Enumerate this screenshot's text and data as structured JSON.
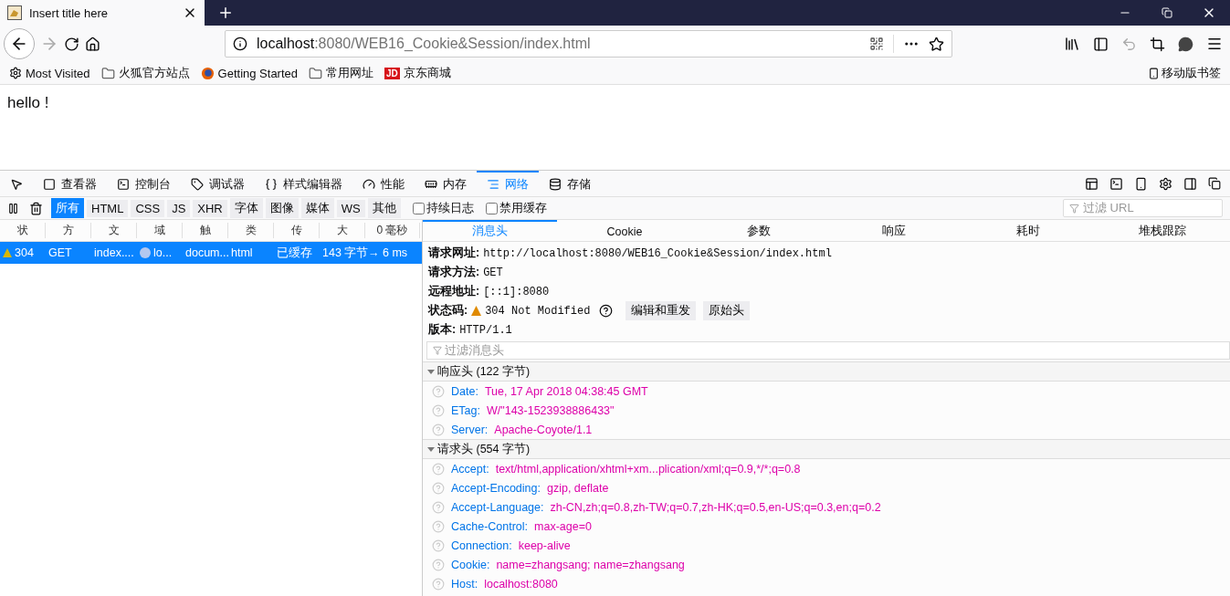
{
  "browser": {
    "tab": {
      "title": "Insert title here"
    },
    "url": {
      "host": "localhost",
      "rest": ":8080/WEB16_Cookie&Session/index.html"
    },
    "bookmarks": [
      {
        "kind": "gear",
        "label": "Most Visited"
      },
      {
        "kind": "folder",
        "label": "火狐官方站点"
      },
      {
        "kind": "firefox",
        "label": "Getting Started"
      },
      {
        "kind": "folder",
        "label": "常用网址"
      },
      {
        "kind": "jd",
        "logo": "JD",
        "label": "京东商城"
      }
    ],
    "mobile_bookmarks": "移动版书签",
    "page_text": "hello !"
  },
  "devtools": {
    "tools": [
      {
        "kind": "viewer",
        "label": "查看器",
        "selected": false
      },
      {
        "kind": "console",
        "label": "控制台",
        "selected": false
      },
      {
        "kind": "debugger",
        "label": "调试器",
        "selected": false
      },
      {
        "kind": "style",
        "label": "样式编辑器",
        "selected": false
      },
      {
        "kind": "perf",
        "label": "性能",
        "selected": false
      },
      {
        "kind": "memory",
        "label": "内存",
        "selected": false
      },
      {
        "kind": "network",
        "label": "网络",
        "selected": true
      },
      {
        "kind": "storage",
        "label": "存储",
        "selected": false
      }
    ],
    "filters": [
      {
        "label": "所有",
        "selected": true
      },
      {
        "label": "HTML",
        "selected": false
      },
      {
        "label": "CSS",
        "selected": false
      },
      {
        "label": "JS",
        "selected": false
      },
      {
        "label": "XHR",
        "selected": false
      },
      {
        "label": "字体",
        "selected": false
      },
      {
        "label": "图像",
        "selected": false
      },
      {
        "label": "媒体",
        "selected": false
      },
      {
        "label": "WS",
        "selected": false
      },
      {
        "label": "其他",
        "selected": false
      }
    ],
    "options": [
      {
        "label": "持续日志",
        "checked": false
      },
      {
        "label": "禁用缓存",
        "checked": false
      }
    ],
    "url_filter": {
      "placeholder": "过滤 URL"
    },
    "columns": [
      "状",
      "方",
      "文",
      "域",
      "触",
      "类",
      "传",
      "大",
      "0 毫秒"
    ],
    "rows": [
      {
        "selected": true,
        "status": "304",
        "method": "GET",
        "file": "index....",
        "domain": "lo...",
        "cause": "docum...",
        "type": "html",
        "transferred": "已缓存",
        "size": "143 字节",
        "timing": "→ 6 ms"
      }
    ],
    "detail_tabs": [
      {
        "label": "消息头",
        "selected": true
      },
      {
        "label": "Cookie",
        "selected": false
      },
      {
        "label": "参数",
        "selected": false
      },
      {
        "label": "响应",
        "selected": false
      },
      {
        "label": "耗时",
        "selected": false
      },
      {
        "label": "堆栈跟踪",
        "selected": false
      }
    ],
    "summary": [
      {
        "kind": "plain",
        "label": "请求网址:",
        "value": "http://localhost:8080/WEB16_Cookie&Session/index.html"
      },
      {
        "kind": "plain",
        "label": "请求方法:",
        "value": "GET"
      },
      {
        "kind": "plain",
        "label": "远程地址:",
        "value": "[::1]:8080"
      },
      {
        "kind": "status",
        "label": "状态码:",
        "value": "304 Not Modified",
        "buttons": [
          "编辑和重发",
          "原始头"
        ]
      },
      {
        "kind": "plain",
        "label": "版本:",
        "value": "HTTP/1.1"
      }
    ],
    "header_filter": {
      "placeholder": "过滤消息头"
    },
    "sections": [
      {
        "title": "响应头 (122 字节)",
        "expanded": true,
        "headers": [
          {
            "name": "Date:",
            "value": "Tue, 17 Apr 2018 04:38:45 GMT"
          },
          {
            "name": "ETag:",
            "value": "W/\"143-1523938886433\""
          },
          {
            "name": "Server:",
            "value": "Apache-Coyote/1.1"
          }
        ]
      },
      {
        "title": "请求头 (554 字节)",
        "expanded": true,
        "headers": [
          {
            "name": "Accept:",
            "value": "text/html,application/xhtml+xm...plication/xml;q=0.9,*/*;q=0.8"
          },
          {
            "name": "Accept-Encoding:",
            "value": "gzip, deflate"
          },
          {
            "name": "Accept-Language:",
            "value": "zh-CN,zh;q=0.8,zh-TW;q=0.7,zh-HK;q=0.5,en-US;q=0.3,en;q=0.2"
          },
          {
            "name": "Cache-Control:",
            "value": "max-age=0"
          },
          {
            "name": "Connection:",
            "value": "keep-alive"
          },
          {
            "name": "Cookie:",
            "value": "name=zhangsang; name=zhangsang"
          },
          {
            "name": "Host:",
            "value": "localhost:8080"
          }
        ]
      }
    ]
  }
}
